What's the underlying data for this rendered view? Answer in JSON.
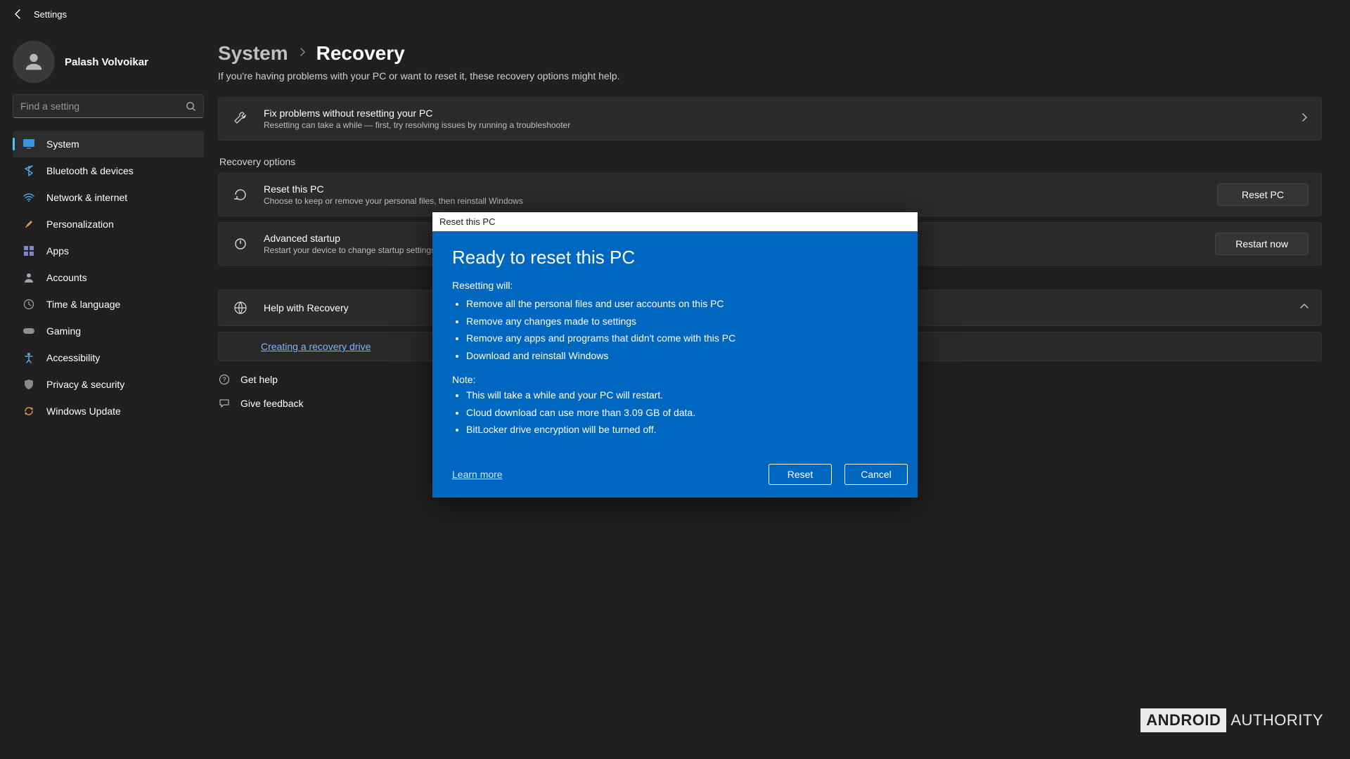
{
  "titlebar": {
    "app_name": "Settings"
  },
  "user": {
    "name": "Palash Volvoikar"
  },
  "search": {
    "placeholder": "Find a setting"
  },
  "nav": {
    "items": [
      {
        "label": "System"
      },
      {
        "label": "Bluetooth & devices"
      },
      {
        "label": "Network & internet"
      },
      {
        "label": "Personalization"
      },
      {
        "label": "Apps"
      },
      {
        "label": "Accounts"
      },
      {
        "label": "Time & language"
      },
      {
        "label": "Gaming"
      },
      {
        "label": "Accessibility"
      },
      {
        "label": "Privacy & security"
      },
      {
        "label": "Windows Update"
      }
    ]
  },
  "breadcrumb": {
    "parent": "System",
    "child": "Recovery"
  },
  "page": {
    "subtitle": "If you're having problems with your PC or want to reset it, these recovery options might help.",
    "troubleshoot": {
      "title": "Fix problems without resetting your PC",
      "desc": "Resetting can take a while — first, try resolving issues by running a troubleshooter"
    },
    "section_label": "Recovery options",
    "reset_card": {
      "title": "Reset this PC",
      "desc": "Choose to keep or remove your personal files, then reinstall Windows",
      "button": "Reset PC"
    },
    "advanced_card": {
      "title": "Advanced startup",
      "desc": "Restart your device to change startup settings",
      "button": "Restart now"
    },
    "help_card": {
      "title": "Help with Recovery"
    },
    "help_link": "Creating a recovery drive",
    "get_help": "Get help",
    "give_feedback": "Give feedback"
  },
  "dialog": {
    "window_title": "Reset this PC",
    "heading": "Ready to reset this PC",
    "lead": "Resetting will:",
    "will": [
      "Remove all the personal files and user accounts on this PC",
      "Remove any changes made to settings",
      "Remove any apps and programs that didn't come with this PC",
      "Download and reinstall Windows"
    ],
    "note_label": "Note:",
    "notes": [
      "This will take a while and your PC will restart.",
      "Cloud download can use more than 3.09 GB of data.",
      "BitLocker drive encryption will be turned off."
    ],
    "learn_more": "Learn more",
    "reset": "Reset",
    "cancel": "Cancel"
  },
  "watermark": {
    "a": "ANDROID",
    "b": "AUTHORITY"
  }
}
